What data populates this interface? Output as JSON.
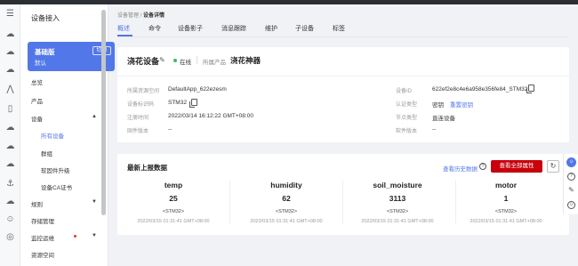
{
  "colors": {
    "accent": "#5277e8",
    "danger_button": "#c7000b",
    "online": "#3fb96d",
    "alarm_dot": "#e63232"
  },
  "sidebar": {
    "title": "设备接入",
    "edition": {
      "name": "基础版",
      "sub": "默认",
      "switch_label": "切换"
    },
    "items": [
      {
        "label": "总览"
      },
      {
        "label": "产品"
      },
      {
        "label": "设备",
        "caret": "▲"
      },
      {
        "label": "所有设备"
      },
      {
        "label": "群组"
      },
      {
        "label": "软固件升级"
      },
      {
        "label": "设备CA证书"
      },
      {
        "label": "规则",
        "caret": "▼"
      },
      {
        "label": "存储管理"
      },
      {
        "label": "监控运维",
        "caret": "▼"
      },
      {
        "label": "资源空间"
      }
    ]
  },
  "rail_icons": [
    "menu-icon",
    "cloud-icon",
    "cloud-icon",
    "cloud-icon",
    "network-icon",
    "device-icon",
    "cloud-icon",
    "cloud-icon",
    "cloud-icon",
    "cloud-icon",
    "anchor-icon",
    "cloud-icon",
    "face-icon",
    "globe-icon"
  ],
  "breadcrumb": {
    "parent": "设备管理",
    "sep": " / ",
    "current": "设备详情"
  },
  "tabs": [
    "概述",
    "命令",
    "设备影子",
    "消息跟踪",
    "维护",
    "子设备",
    "标签"
  ],
  "device": {
    "name": "浇花设备",
    "edit_icon": "✎",
    "status": "在线",
    "product_label": "所属产品",
    "product": "浇花神器",
    "fields_left": [
      {
        "label": "所属资源空间",
        "value": "DefaultApp_622ezesm"
      },
      {
        "label": "设备标识码",
        "value": "STM32"
      },
      {
        "label": "注册时间",
        "value": "2022/03/14 16:12:22 GMT+08:00"
      },
      {
        "label": "固件版本",
        "value": "--"
      }
    ],
    "fields_right": [
      {
        "label": "设备ID",
        "value": "622ef2e8c4e6a958e356fe84_STM32"
      },
      {
        "label": "认证类型",
        "value": "密钥",
        "link": "重置密钥"
      },
      {
        "label": "节点类型",
        "value": "直连设备"
      },
      {
        "label": "软件版本",
        "value": "--"
      }
    ]
  },
  "report": {
    "title": "最新上报数据",
    "history_link": "查看历史数据",
    "all_props_button": "查看全部属性",
    "refresh_icon": "↻",
    "props": [
      {
        "name": "temp",
        "value": "25",
        "device": "<STM32>",
        "time": "2022/03/15 01:31:41 GMT+08:00"
      },
      {
        "name": "humidity",
        "value": "62",
        "device": "<STM32>",
        "time": "2022/03/15 01:31:41 GMT+08:00"
      },
      {
        "name": "soil_moisture",
        "value": "3113",
        "device": "<STM32>",
        "time": "2022/03/15 01:31:41 GMT+08:00"
      },
      {
        "name": "motor",
        "value": "1",
        "device": "<STM32>",
        "time": "2022/03/15 01:31:41 GMT+08:00"
      }
    ]
  },
  "right_rail": [
    "chat-icon",
    "help-icon",
    "edit-icon",
    "smile-icon"
  ]
}
